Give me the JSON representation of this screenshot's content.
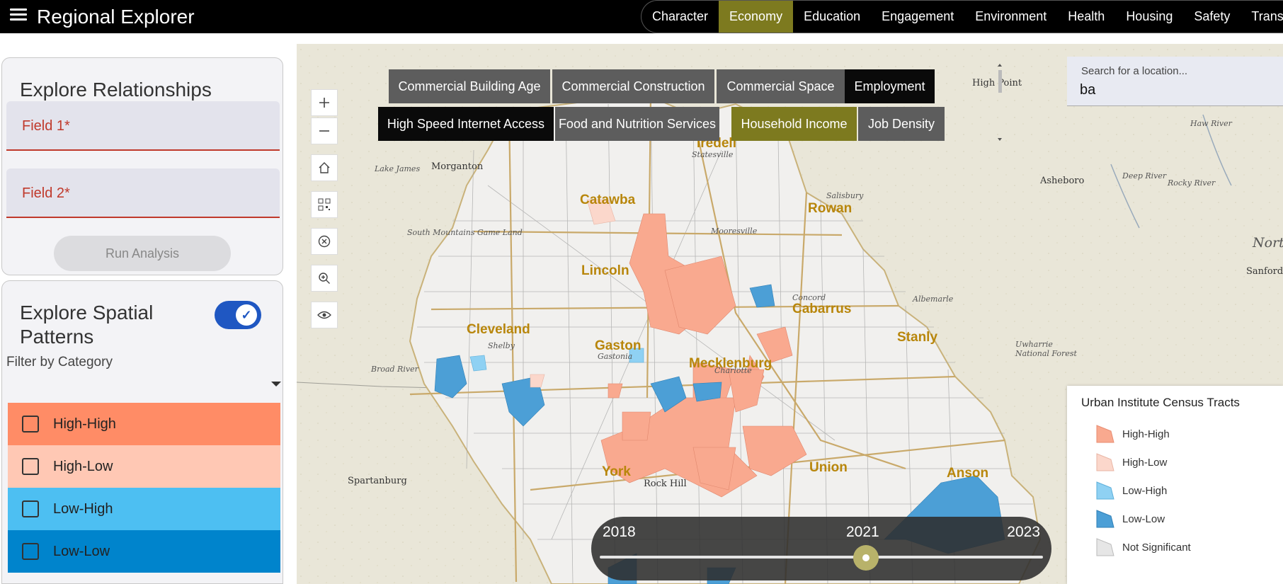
{
  "header": {
    "title": "Regional Explorer",
    "nav": [
      "Character",
      "Economy",
      "Education",
      "Engagement",
      "Environment",
      "Health",
      "Housing",
      "Safety",
      "Transpo"
    ],
    "active_nav": "Economy"
  },
  "left_panel": {
    "relationships": {
      "title": "Explore Relationships",
      "field1": "Field 1*",
      "field2": "Field 2*",
      "run_button": "Run Analysis"
    },
    "spatial": {
      "title": "Explore Spatial Patterns",
      "toggle_on": true,
      "filter_label": "Filter by Category",
      "options": [
        {
          "label": "High-High",
          "color": "#ff8c66"
        },
        {
          "label": "High-Low",
          "color": "#ffc8b4"
        },
        {
          "label": "Low-High",
          "color": "#4dbff2"
        },
        {
          "label": "Low-Low",
          "color": "#0084cc"
        }
      ]
    }
  },
  "categories": [
    {
      "label": "Commercial Building Age",
      "style": "grey"
    },
    {
      "label": "Commercial Construction",
      "style": "grey"
    },
    {
      "label": "Commercial Space",
      "style": "grey"
    },
    {
      "label": "Employment",
      "style": "black"
    },
    {
      "label": "High Speed Internet Access",
      "style": "black"
    },
    {
      "label": "Food and Nutrition Services",
      "style": "grey"
    },
    {
      "label": "Household Income",
      "style": "olive"
    },
    {
      "label": "Job Density",
      "style": "grey"
    }
  ],
  "search": {
    "placeholder": "Search for a location...",
    "value": "ba"
  },
  "map": {
    "counties": [
      "Iredell",
      "Catawba",
      "Rowan",
      "Lincoln",
      "Cleveland",
      "Gaston",
      "Mecklenburg",
      "Cabarrus",
      "Stanly",
      "York",
      "Union",
      "Anson"
    ],
    "places": [
      "Morganton",
      "Lake James",
      "Statesville",
      "South Mountains Game Land",
      "Mooresville",
      "Salisbury",
      "Asheboro",
      "High Point",
      "Concord",
      "Albemarle",
      "Shelby",
      "Gastonia",
      "Charlotte",
      "Uwharrie National Forest",
      "Broad River",
      "Spartanburg",
      "Rock Hill",
      "Sanford",
      "Deep River",
      "Rocky River",
      "Haw River",
      "North Caro"
    ],
    "controls": [
      "zoom-in",
      "zoom-out",
      "home",
      "qr",
      "clear",
      "magnify",
      "visibility"
    ]
  },
  "legend": {
    "title": "Urban Institute Census Tracts",
    "items": [
      {
        "label": "High-High",
        "color": "#f9a98f"
      },
      {
        "label": "High-Low",
        "color": "#fbd7cb"
      },
      {
        "label": "Low-High",
        "color": "#8fd1f3"
      },
      {
        "label": "Low-Low",
        "color": "#4c9fd6"
      },
      {
        "label": "Not Significant",
        "color": "#e6e6e6"
      }
    ]
  },
  "timeline": {
    "start": "2018",
    "current": "2021",
    "end": "2023",
    "position_fraction": 0.6
  }
}
